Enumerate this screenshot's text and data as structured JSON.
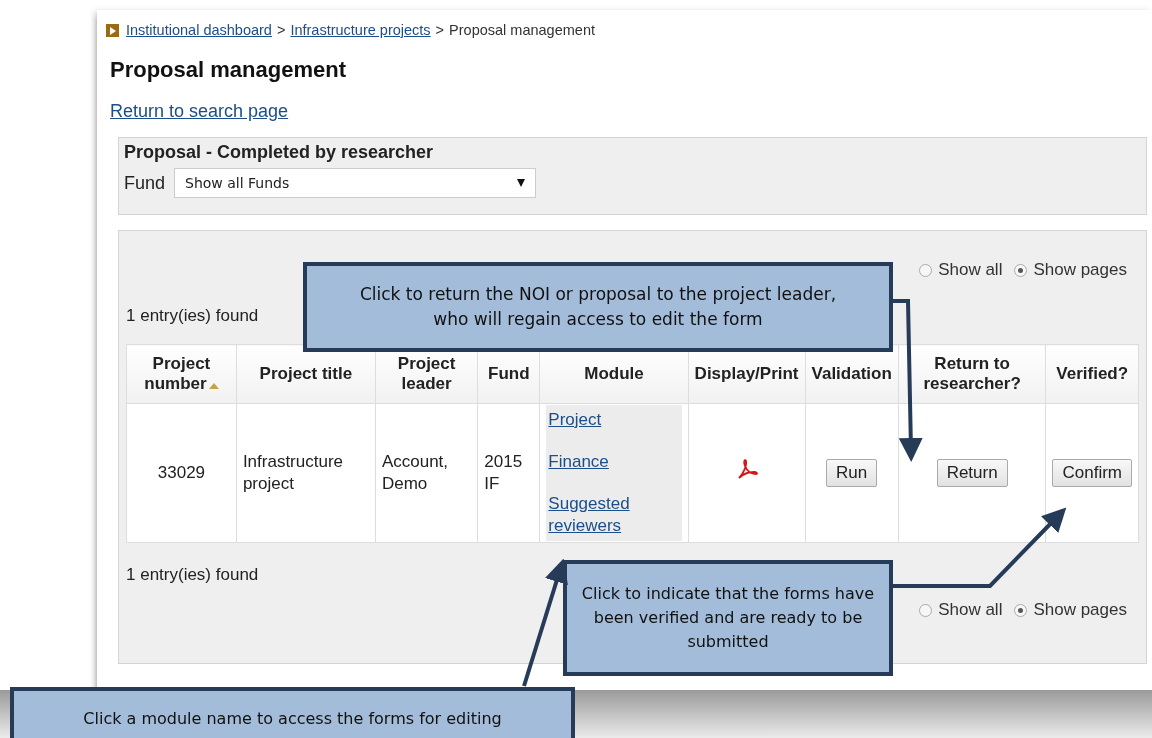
{
  "breadcrumb": [
    {
      "label": "Institutional dashboard",
      "link": true
    },
    {
      "separator": ">",
      "label": "Infrastructure projects",
      "link": true
    },
    {
      "separator": ">",
      "label": "Proposal management",
      "link": false
    }
  ],
  "heading": "Proposal management",
  "return_link": "Return to search page",
  "filter": {
    "title": "Proposal - Completed by researcher",
    "label": "Fund",
    "value": "Show all Funds"
  },
  "results_top": {
    "count": "1 entry(ies) found",
    "options": [
      {
        "label": "Show all",
        "selected": false
      },
      {
        "label": "Show pages",
        "selected": true
      }
    ]
  },
  "table": {
    "columns": [
      {
        "label": "Project number",
        "sorted": true
      },
      {
        "label": "Project title",
        "sorted": false
      },
      {
        "label": "Project leader",
        "sorted": false
      },
      {
        "label": "Fund",
        "sorted": false
      },
      {
        "label": "Module",
        "sorted": false
      },
      {
        "label": "Display/Print",
        "sorted": false
      },
      {
        "label": "Validation",
        "sorted": false
      },
      {
        "label": "Return to researcher?",
        "sorted": false
      },
      {
        "label": "Verified?",
        "sorted": false
      }
    ],
    "rows": [
      {
        "project_number": "33029",
        "project_title": "Infrastructure project",
        "project_leader": "Account, Demo",
        "fund": "2015 IF",
        "modules": [
          "Project",
          "Finance",
          "Suggested reviewers"
        ],
        "validation": "Run",
        "return": "Return",
        "verified": "Confirm"
      }
    ]
  },
  "results_bottom": {
    "count": "1 entry(ies) found",
    "options": [
      {
        "label": "Show all",
        "selected": false
      },
      {
        "label": "Show pages",
        "selected": true
      }
    ]
  },
  "callouts": [
    {
      "text": "Click to return the NOI or proposal to the project leader, who will regain access to edit the form"
    },
    {
      "text": "Click to indicate that the forms have been verified and are ready to be submitted"
    },
    {
      "text": "Click a module name to access the forms for editing"
    }
  ]
}
